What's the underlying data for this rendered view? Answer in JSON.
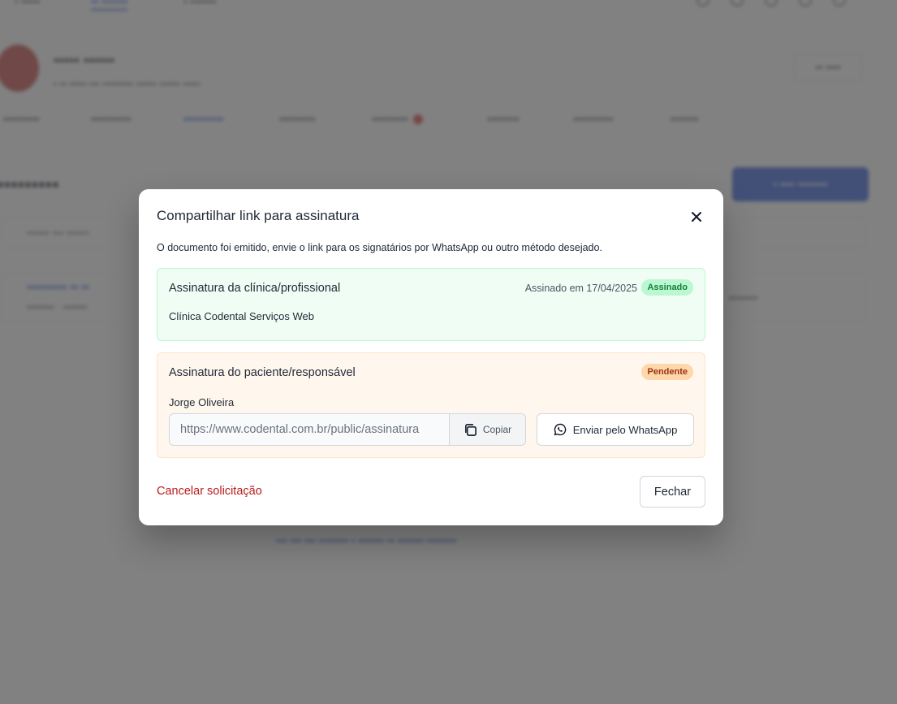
{
  "modal": {
    "title": "Compartilhar link para assinatura",
    "description": "O documento foi emitido, envie o link para os signatários por WhatsApp ou outro método desejado.",
    "clinic_signature": {
      "heading": "Assinatura da clínica/profissional",
      "signed_date": "Assinado em 17/04/2025",
      "status": "Assinado",
      "signer": "Clínica Codental Serviços Web"
    },
    "patient_signature": {
      "heading": "Assinatura do paciente/responsável",
      "status": "Pendente",
      "signer": "Jorge Oliveira",
      "link": "https://www.codental.com.br/public/assinatura",
      "copy_label": "Copiar",
      "whatsapp_label": "Enviar pelo WhatsApp"
    },
    "cancel_label": "Cancelar solicitação",
    "close_label": "Fechar"
  },
  "colors": {
    "overlay": "#505050",
    "signed_bg": "#f0fdf4",
    "pending_bg": "#fff7ed",
    "danger": "#b91c1c",
    "primary": "#1d4ed8"
  }
}
